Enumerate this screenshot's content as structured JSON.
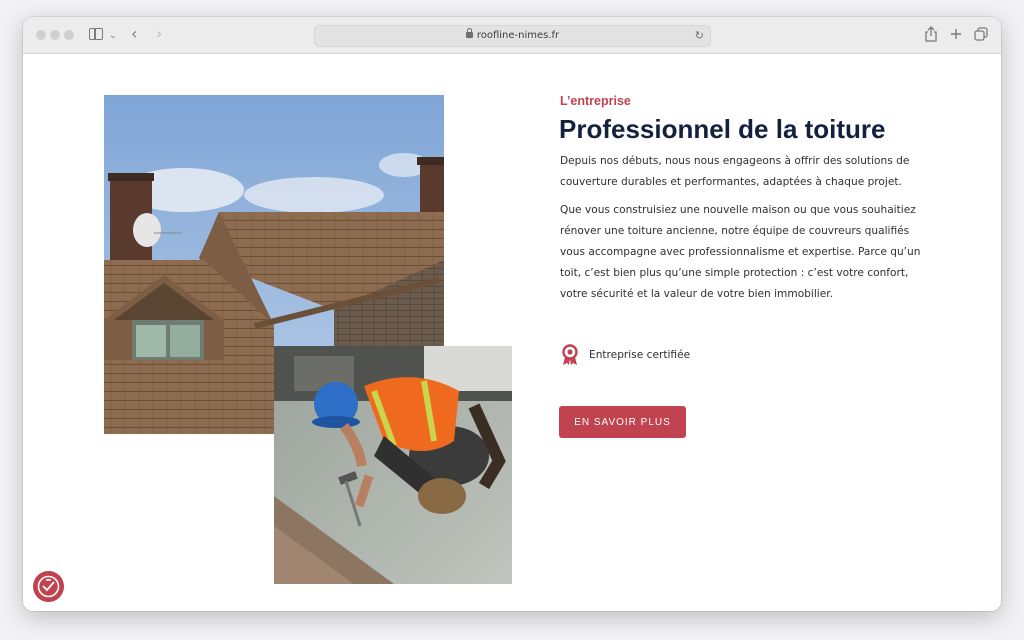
{
  "browser": {
    "url": "roofline-nimes.fr"
  },
  "content": {
    "eyebrow": "L’entreprise",
    "title": "Professionnel de la toiture",
    "paragraph1": "Depuis nos débuts, nous nous engageons à offrir des solutions de couverture durables et performantes, adaptées à chaque projet.",
    "paragraph2": "Que vous construisiez une nouvelle maison ou que vous souhaitiez rénover une toiture ancienne, notre équipe de couvreurs qualifiés vous accompagne avec professionnalisme et expertise. Parce qu’un toit, c’est bien plus qu’une simple protection : c’est votre confort, votre sécurité et la valeur de votre bien immobilier.",
    "badge_label": "Entreprise certifiée",
    "cta_label": "EN SAVOIR PLUS"
  },
  "icons": {
    "badge": "award-ribbon-icon",
    "accessibility": "accessibility-icon"
  },
  "colors": {
    "accent": "#c0434f",
    "heading": "#13213f",
    "text": "#2f2f35"
  }
}
